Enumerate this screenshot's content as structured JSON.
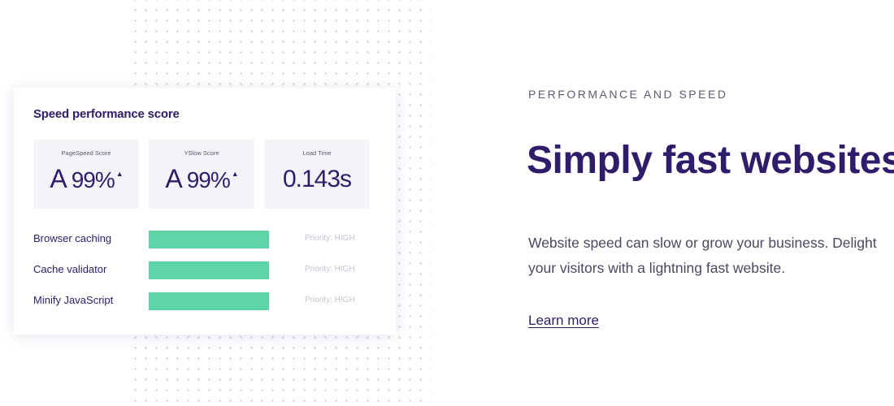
{
  "card": {
    "title": "Speed performance score",
    "metrics": [
      {
        "label": "PageSpeed Score",
        "grade": "A",
        "value": "99%",
        "arrow": "▲"
      },
      {
        "label": "YSlow Score",
        "grade": "A",
        "value": "99%",
        "arrow": "▲"
      },
      {
        "label": "Load Time",
        "value": "0.143s"
      }
    ],
    "rows": [
      {
        "label": "Browser caching",
        "priority": "Priority: HIGH",
        "progress": 1.0
      },
      {
        "label": "Cache validator",
        "priority": "Priority: HIGH",
        "progress": 1.0
      },
      {
        "label": "Minify JavaScript",
        "priority": "Priority: HIGH",
        "progress": 1.0
      }
    ]
  },
  "section": {
    "eyebrow": "PERFORMANCE AND SPEED",
    "headline": "Simply fast websites",
    "description": "Website speed can slow or grow your business. Delight your visitors with a lightning fast website.",
    "link": "Learn more"
  },
  "colors": {
    "brand": "#2f1c6a",
    "bar": "#5fd5a7",
    "card_tile": "#f4f4f8"
  }
}
